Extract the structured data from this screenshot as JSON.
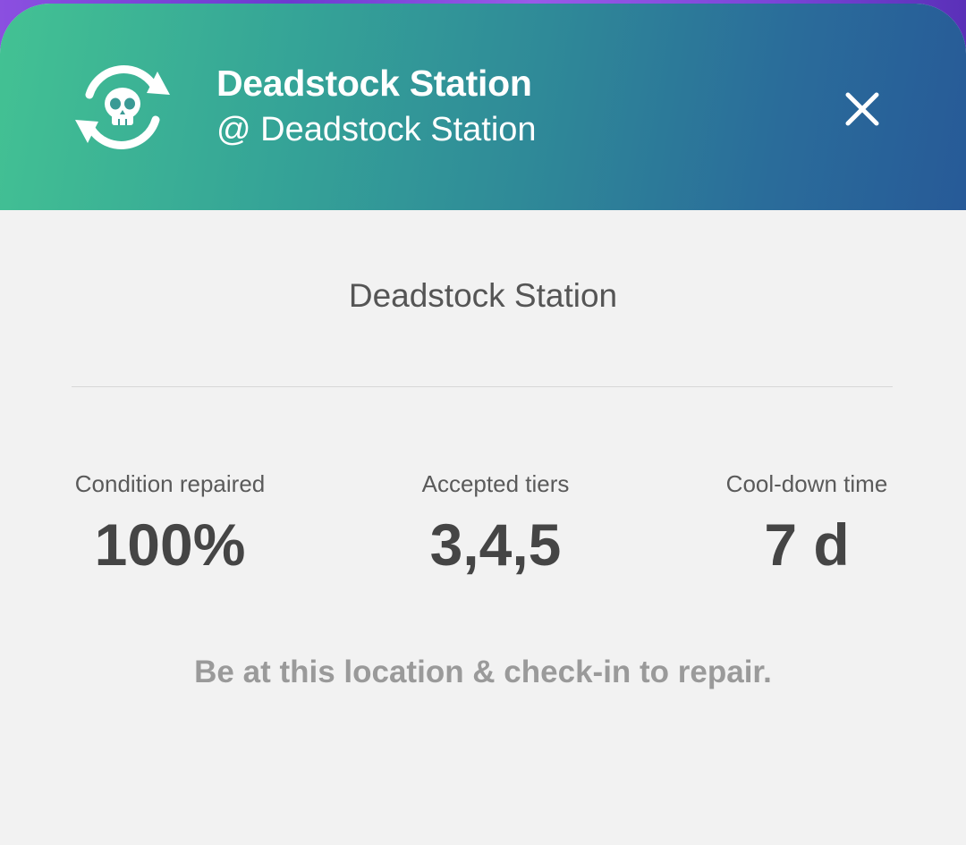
{
  "header": {
    "title": "Deadstock Station",
    "subtitle": "@ Deadstock Station",
    "icon": "skull-repair-cycle-icon",
    "close_icon": "close-icon",
    "gradient_start": "#43c293",
    "gradient_end": "#275a98"
  },
  "body": {
    "title": "Deadstock Station",
    "stats": [
      {
        "label": "Condition repaired",
        "value": "100%"
      },
      {
        "label": "Accepted tiers",
        "value": "3,4,5"
      },
      {
        "label": "Cool-down time",
        "value": "7 d"
      }
    ],
    "hint": "Be at this location & check-in to repair."
  }
}
